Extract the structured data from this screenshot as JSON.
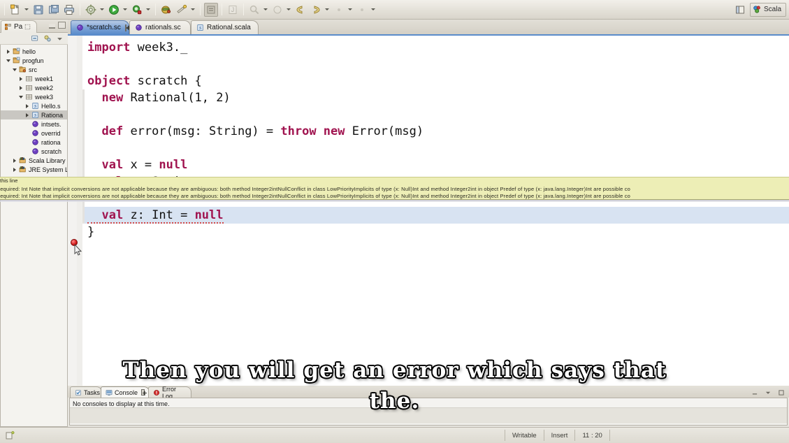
{
  "window": {
    "perspective_label": "Scala"
  },
  "toolbar": {
    "items": [
      {
        "name": "new-wizard",
        "icon": "new-file-icon",
        "dropdown": true
      },
      {
        "name": "save",
        "icon": "save-icon",
        "dropdown": false
      },
      {
        "name": "save-all",
        "icon": "save-all-icon",
        "dropdown": false
      },
      {
        "name": "print",
        "icon": "print-icon",
        "dropdown": false
      },
      {
        "name": "build",
        "icon": "gear-icon",
        "dropdown": true
      },
      {
        "name": "run",
        "icon": "run-icon",
        "dropdown": true
      },
      {
        "name": "debug",
        "icon": "debug-icon",
        "dropdown": true
      },
      {
        "name": "scala-console",
        "icon": "scala-icon",
        "dropdown": false
      },
      {
        "name": "quick-fix",
        "icon": "wand-icon",
        "dropdown": true
      },
      {
        "name": "toggle-markers",
        "icon": "marker-icon",
        "dropdown": false
      },
      {
        "name": "new-class",
        "icon": "class-icon",
        "dropdown": false
      },
      {
        "name": "search",
        "icon": "search-icon",
        "dropdown": true
      },
      {
        "name": "open-type",
        "icon": "type-icon",
        "dropdown": true
      },
      {
        "name": "back",
        "icon": "back-arrow-icon",
        "dropdown": false
      },
      {
        "name": "forward",
        "icon": "forward-arrow-icon",
        "dropdown": true
      },
      {
        "name": "extra-1",
        "icon": "dot-icon",
        "dropdown": false
      },
      {
        "name": "extra-2",
        "icon": "dot-icon",
        "dropdown": false
      }
    ]
  },
  "package_explorer": {
    "tab_label": "Pa",
    "toolbar": [
      {
        "name": "collapse-all",
        "icon": "collapse-all-icon"
      },
      {
        "name": "link-with-editor",
        "icon": "gears-icon"
      },
      {
        "name": "view-menu",
        "icon": "chevron-down-icon"
      }
    ],
    "tree": [
      {
        "label": "hello",
        "indent": 0,
        "twisty": "closed",
        "icon": "project-icon",
        "selected": false
      },
      {
        "label": "progfun",
        "indent": 0,
        "twisty": "open",
        "icon": "project-icon",
        "selected": false
      },
      {
        "label": "src",
        "indent": 1,
        "twisty": "open",
        "icon": "source-folder-icon",
        "selected": false
      },
      {
        "label": "week1",
        "indent": 2,
        "twisty": "closed",
        "icon": "package-icon",
        "selected": false
      },
      {
        "label": "week2",
        "indent": 2,
        "twisty": "closed",
        "icon": "package-icon",
        "selected": false
      },
      {
        "label": "week3",
        "indent": 2,
        "twisty": "open",
        "icon": "package-icon",
        "selected": false
      },
      {
        "label": "Hello.s",
        "indent": 3,
        "twisty": "closed",
        "icon": "scala-file-icon",
        "selected": false
      },
      {
        "label": "Rationa",
        "indent": 3,
        "twisty": "closed",
        "icon": "scala-file-icon",
        "selected": true
      },
      {
        "label": "intsets.",
        "indent": 3,
        "twisty": "none",
        "icon": "worksheet-icon",
        "selected": false
      },
      {
        "label": "overrid",
        "indent": 3,
        "twisty": "none",
        "icon": "worksheet-icon",
        "selected": false
      },
      {
        "label": "rationa",
        "indent": 3,
        "twisty": "none",
        "icon": "worksheet-icon",
        "selected": false
      },
      {
        "label": "scratch",
        "indent": 3,
        "twisty": "none",
        "icon": "worksheet-icon",
        "selected": false
      },
      {
        "label": "Scala Library",
        "indent": 1,
        "twisty": "closed",
        "icon": "library-icon",
        "selected": false
      },
      {
        "label": "JRE System Li",
        "indent": 1,
        "twisty": "closed",
        "icon": "library-icon",
        "selected": false
      }
    ]
  },
  "editor": {
    "tabs": [
      {
        "label": "*scratch.sc",
        "icon": "worksheet-icon",
        "active": true,
        "closable": true
      },
      {
        "label": "rationals.sc",
        "icon": "worksheet-icon",
        "active": false,
        "closable": false
      },
      {
        "label": "Rational.scala",
        "icon": "scala-file-icon",
        "active": false,
        "closable": false
      }
    ],
    "lines": [
      {
        "tokens": [
          {
            "t": "import",
            "k": true
          },
          {
            "t": " week3._",
            "k": false
          }
        ],
        "bar": false,
        "selected": false,
        "error": false
      },
      {
        "tokens": [],
        "bar": false,
        "selected": false,
        "error": false
      },
      {
        "tokens": [
          {
            "t": "object",
            "k": true
          },
          {
            "t": " scratch {",
            "k": false
          }
        ],
        "bar": false,
        "selected": false,
        "error": false
      },
      {
        "tokens": [
          {
            "t": "  ",
            "k": false
          },
          {
            "t": "new",
            "k": true
          },
          {
            "t": " Rational(1, 2)",
            "k": false
          }
        ],
        "bar": true,
        "selected": false,
        "error": false
      },
      {
        "tokens": [],
        "bar": true,
        "selected": false,
        "error": false
      },
      {
        "tokens": [
          {
            "t": "  ",
            "k": false
          },
          {
            "t": "def",
            "k": true
          },
          {
            "t": " error(msg: String) = ",
            "k": false
          },
          {
            "t": "throw new",
            "k": true
          },
          {
            "t": " Error(msg)",
            "k": false
          }
        ],
        "bar": true,
        "selected": false,
        "error": false
      },
      {
        "tokens": [],
        "bar": true,
        "selected": false,
        "error": false
      },
      {
        "tokens": [
          {
            "t": "  ",
            "k": false
          },
          {
            "t": "val",
            "k": true
          },
          {
            "t": " x = ",
            "k": false
          },
          {
            "t": "null",
            "k": true
          }
        ],
        "bar": true,
        "selected": false,
        "error": false
      },
      {
        "tokens": [
          {
            "t": "  ",
            "k": false
          },
          {
            "t": "val",
            "k": true
          },
          {
            "t": " y: String = x",
            "k": false
          }
        ],
        "bar": true,
        "selected": false,
        "error": false
      },
      {
        "tokens": [],
        "bar": true,
        "selected": false,
        "error": false
      },
      {
        "tokens": [
          {
            "t": "  ",
            "k": false
          },
          {
            "t": "val",
            "k": true
          },
          {
            "t": " z: Int = ",
            "k": false
          },
          {
            "t": "null",
            "k": true
          }
        ],
        "bar": true,
        "selected": true,
        "error": true
      },
      {
        "tokens": [
          {
            "t": "}",
            "k": false
          }
        ],
        "bar": false,
        "selected": false,
        "error": false
      }
    ],
    "error_marker_name": "error-marker-icon"
  },
  "error_tooltip": {
    "head": "this line",
    "text": "found   : Null(null)  required: Int Note that implicit conversions are not applicable because they are ambiguous:  both method Integer2intNullConflict in class LowPriorityImplicits of type (x: Null)Int  and method Integer2int in object Predef of type (x: java.lang.Integer)Int  are possible co"
  },
  "console_panel": {
    "tabs": [
      {
        "label": "Tasks",
        "icon": "tasks-icon",
        "active": false,
        "closable": false
      },
      {
        "label": "Console",
        "icon": "console-icon",
        "active": true,
        "closable": true
      },
      {
        "label": "Error Log",
        "icon": "error-log-icon",
        "active": false,
        "closable": false
      }
    ],
    "message": "No consoles to display at this time."
  },
  "status_bar": {
    "writable": "Writable",
    "insert": "Insert",
    "position": "11 : 20"
  },
  "subtitle": {
    "line1": "Then you will get an error which says that",
    "line2": "the."
  },
  "colors": {
    "keyword": "#a0134f",
    "tooltip_bg": "#edeeb6",
    "active_tab": "#5a8ccb",
    "selection": "#d8e3f2",
    "error": "#d01414"
  }
}
